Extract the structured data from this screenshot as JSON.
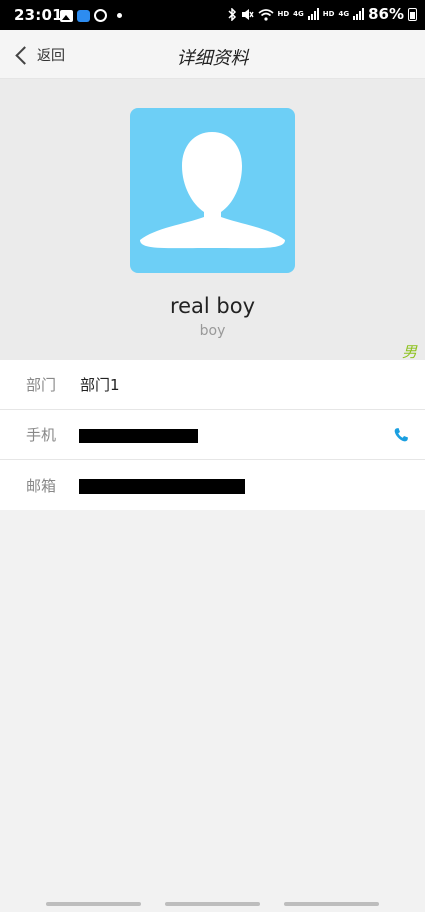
{
  "status_bar": {
    "time": "23:01",
    "battery": "86%",
    "network_badges": [
      "HD",
      "4G",
      "HD",
      "4G"
    ]
  },
  "header": {
    "back_label": "返回",
    "title": "详细资料"
  },
  "profile": {
    "display_name": "real boy",
    "username": "boy",
    "gender": "男"
  },
  "info": {
    "department_label": "部门",
    "department_value": "部门1",
    "phone_label": "手机",
    "email_label": "邮箱"
  },
  "colors": {
    "avatar_bg": "#6dcff6",
    "gender": "#8dc21f",
    "phone_icon": "#1a9fe0"
  },
  "icons": [
    "image-icon",
    "app-icon",
    "sync-icon",
    "bluetooth-icon",
    "mute-icon",
    "wifi-icon",
    "signal-icon",
    "battery-icon",
    "back-chevron-icon",
    "phone-icon"
  ]
}
